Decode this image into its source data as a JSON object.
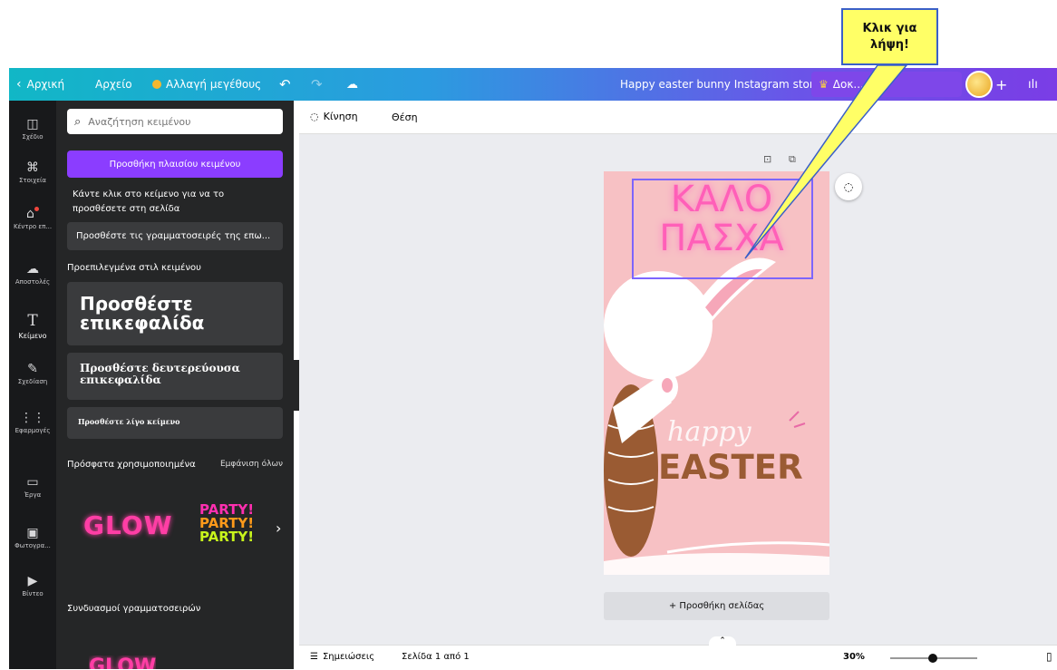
{
  "topbar": {
    "home": "Αρχική",
    "file": "Αρχείο",
    "resize": "Αλλαγή μεγέθους",
    "title": "Happy easter bunny Instagram story",
    "try_pro_visible": "Δοκ... Pro",
    "plus": "+"
  },
  "rail": [
    {
      "label": "Σχέδιο",
      "icon": "layout-icon"
    },
    {
      "label": "Στοιχεία",
      "icon": "shapes-icon"
    },
    {
      "label": "Κέντρο επ...",
      "icon": "brand-icon"
    },
    {
      "label": "Αποστολές",
      "icon": "upload-icon"
    },
    {
      "label": "Κείμενο",
      "icon": "text-icon"
    },
    {
      "label": "Σχεδίαση",
      "icon": "draw-icon"
    },
    {
      "label": "Εφαρμογές",
      "icon": "apps-icon"
    },
    {
      "label": "Έργα",
      "icon": "folder-icon"
    },
    {
      "label": "Φωτογρα...",
      "icon": "photo-icon"
    },
    {
      "label": "Βίντεο",
      "icon": "video-icon"
    }
  ],
  "panel": {
    "search_placeholder": "Αναζήτηση κειμένου",
    "add_textbox": "Προσθήκη πλαισίου κειμένου",
    "hint": "Κάντε κλικ στο κείμενο για να το προσθέσετε στη σελίδα",
    "brand_fonts": "Προσθέστε τις γραμματοσειρές της επω...",
    "default_styles": "Προεπιλεγμένα στιλ κειμένου",
    "heading": "Προσθέστε επικεφαλίδα",
    "subheading": "Προσθέστε δευτερεύουσα επικεφαλίδα",
    "body": "Προσθέστε λίγο κείμενο",
    "recent": "Πρόσφατα χρησιμοποιημένα",
    "see_all": "Εμφάνιση όλων",
    "recent_glow": "GLOW",
    "recent_party": [
      "PARTY!",
      "PARTY!",
      "PARTY!"
    ],
    "combos": "Συνδυασμοί γραμματοσειρών",
    "combo_glow": "GLOW"
  },
  "subbar": {
    "motion": "Κίνηση",
    "position": "Θέση"
  },
  "design": {
    "line1": "ΚΑΛΟ",
    "line2": "ΠΑΣΧΑ",
    "happy": "happy",
    "easter": "EASTER"
  },
  "add_page": "+ Προσθήκη σελίδας",
  "bottom": {
    "notes": "Σημειώσεις",
    "page_info": "Σελίδα 1 από 1",
    "zoom": "30%",
    "zoom_level": 0.3
  },
  "callout": {
    "line1": "Κλικ για",
    "line2": "λήψη!"
  },
  "colors": {
    "brand_purple": "#8b3dff",
    "canvas_pink": "#f7c1c4",
    "neon_pink": "#ff5fb8",
    "easter_brown": "#9a5b33",
    "callout_yellow": "#ffff66"
  }
}
